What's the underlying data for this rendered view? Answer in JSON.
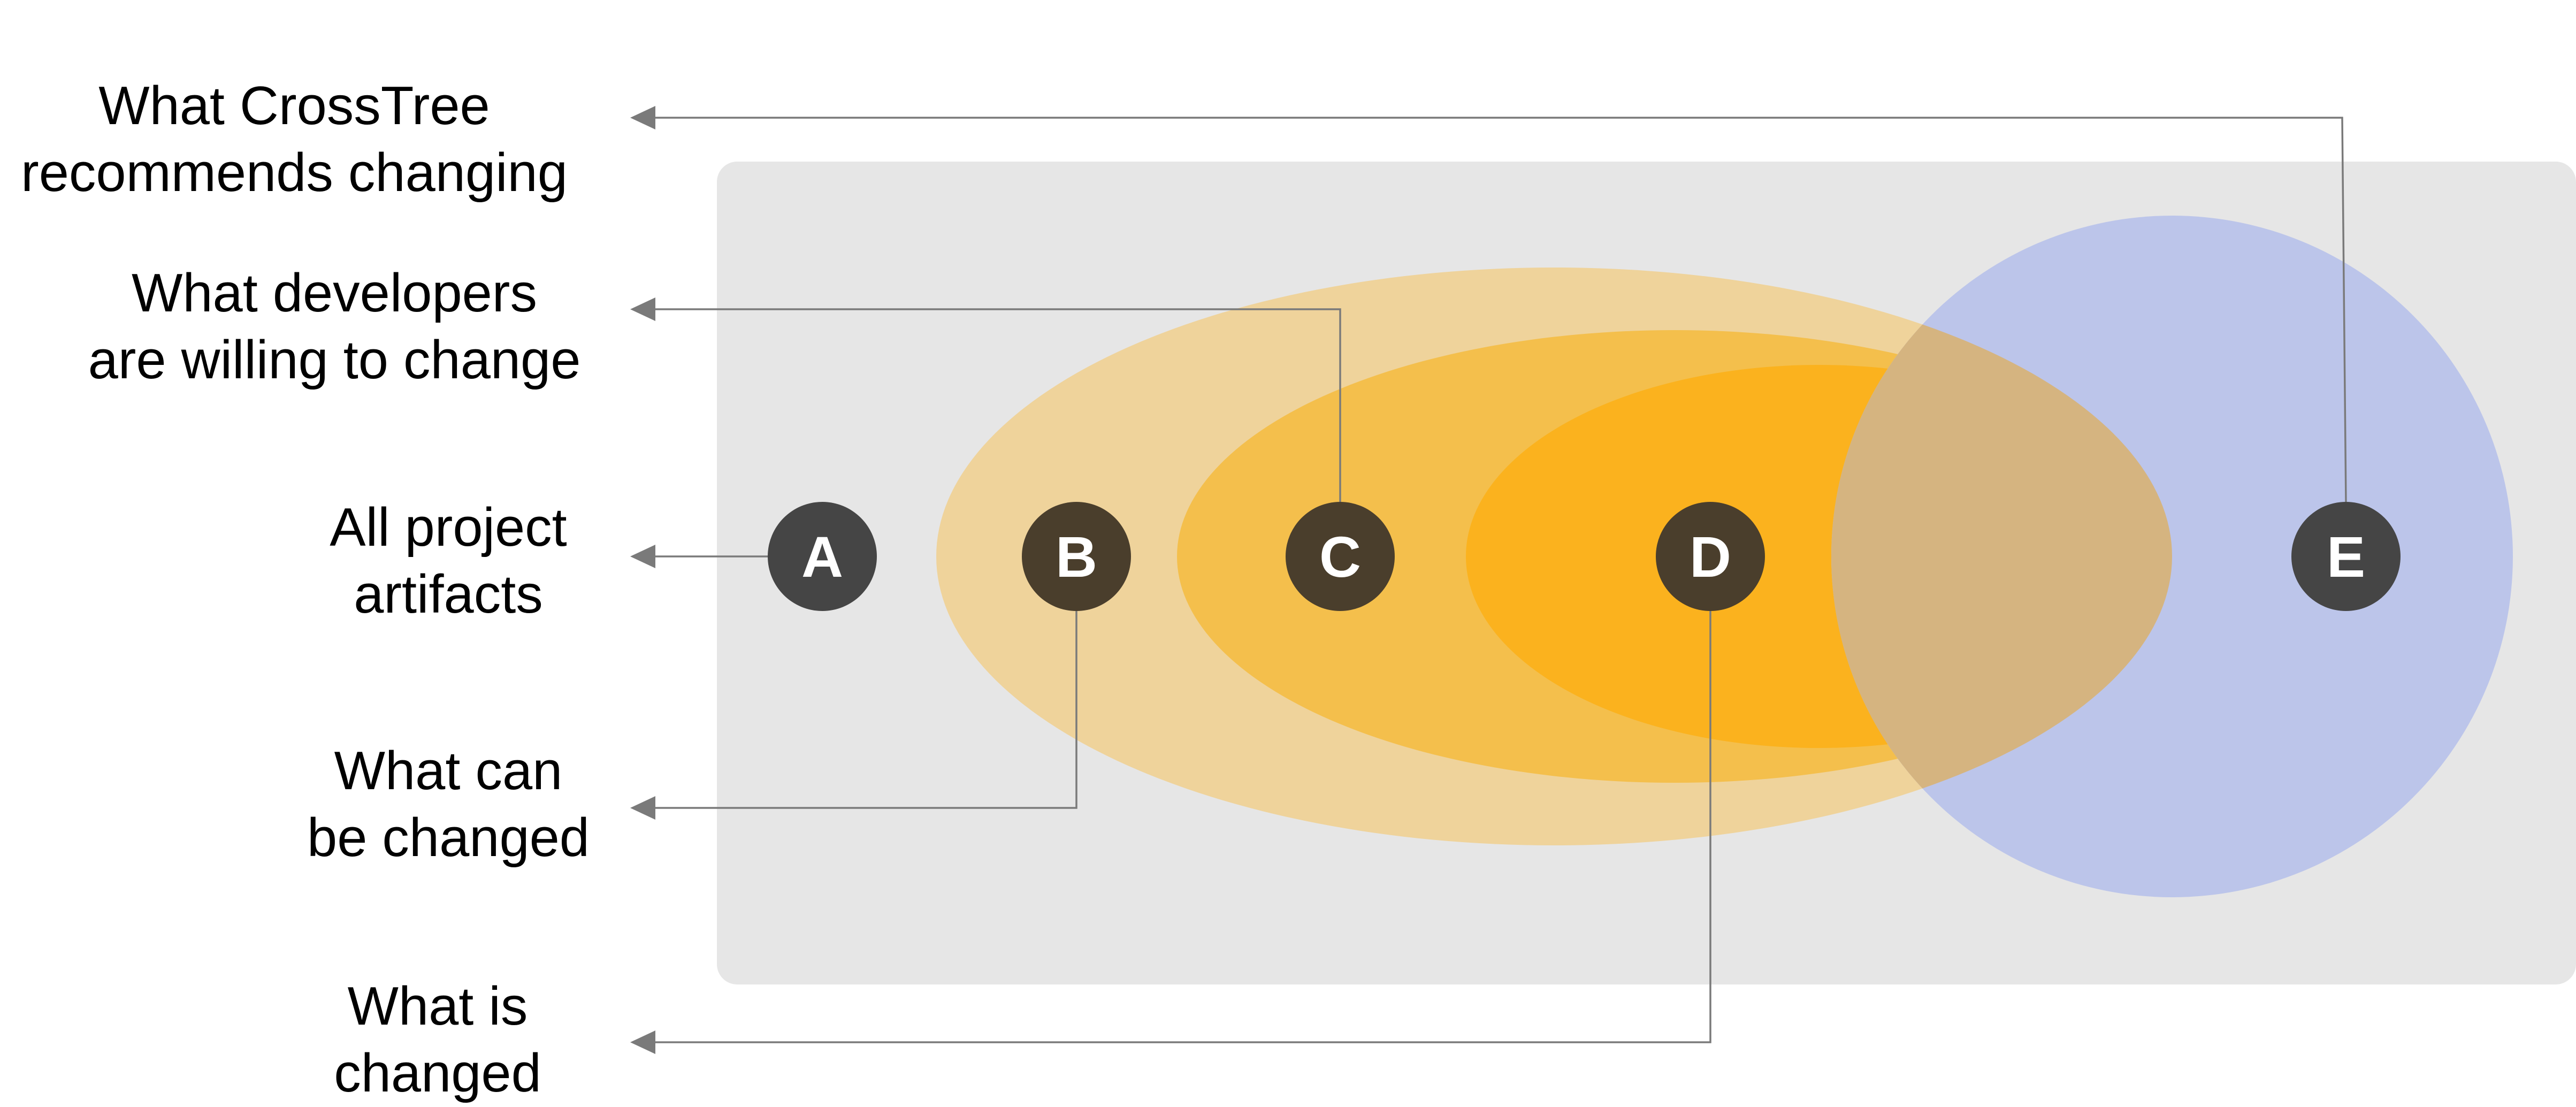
{
  "colors": {
    "panel": "#e6e6e6",
    "all_project_artifacts": "#efd39b",
    "developers_willing": "#f4bf4c",
    "is_changed": "#fbb21e",
    "crosstree_recommends": "#bcc5ea",
    "overlap": "#d5b480",
    "marker_neutral": "#454545",
    "marker_warm": "#4a3e2c",
    "connector": "#7a7a7a",
    "marker_text": "#ffffff",
    "label_text": "#000000"
  },
  "labels": {
    "crosstree": [
      "What CrossTree",
      "recommends changing"
    ],
    "developers": [
      "What developers",
      "are willing to change"
    ],
    "all_artifacts": [
      "All project",
      "artifacts"
    ],
    "can_change": [
      "What can",
      "be changed"
    ],
    "is_changed": [
      "What is",
      "changed"
    ]
  },
  "markers": {
    "a": "A",
    "b": "B",
    "c": "C",
    "d": "D",
    "e": "E"
  }
}
